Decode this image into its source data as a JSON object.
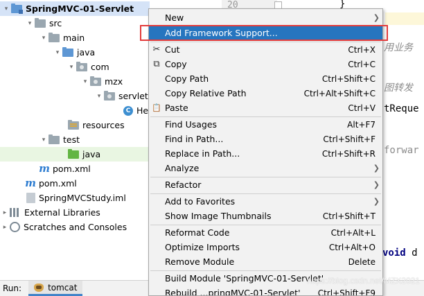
{
  "tree": {
    "items": [
      {
        "label": "SpringMVC-01-Servlet",
        "icon": "module-folder-icon",
        "arrow": "▾",
        "indent": 0
      },
      {
        "label": "src",
        "icon": "folder-icon",
        "arrow": "▾",
        "indent": 1
      },
      {
        "label": "main",
        "icon": "folder-icon",
        "arrow": "▾",
        "indent": 2
      },
      {
        "label": "java",
        "icon": "source-folder-icon",
        "arrow": "▾",
        "indent": 3
      },
      {
        "label": "com",
        "icon": "package-icon",
        "arrow": "▾",
        "indent": 4
      },
      {
        "label": "mzx",
        "icon": "package-icon",
        "arrow": "▾",
        "indent": 5
      },
      {
        "label": "servlet",
        "icon": "package-icon",
        "arrow": "▾",
        "indent": 6
      },
      {
        "label": "Hel",
        "icon": "java-class-icon",
        "arrow": "",
        "indent": 7
      },
      {
        "label": "resources",
        "icon": "resources-folder-icon",
        "arrow": "",
        "indent": 3
      },
      {
        "label": "test",
        "icon": "folder-icon",
        "arrow": "▾",
        "indent": 2
      },
      {
        "label": "java",
        "icon": "test-source-folder-icon",
        "arrow": "",
        "indent": 3
      },
      {
        "label": "pom.xml",
        "icon": "maven-icon",
        "arrow": "",
        "indent": 2
      },
      {
        "label": "pom.xml",
        "icon": "maven-icon",
        "arrow": "",
        "indent": 1
      },
      {
        "label": "SpringMVCStudy.iml",
        "icon": "iml-file-icon",
        "arrow": "",
        "indent": 1
      },
      {
        "label": "External Libraries",
        "icon": "libraries-icon",
        "arrow": "▸",
        "indent": 0
      },
      {
        "label": "Scratches and Consoles",
        "icon": "scratches-icon",
        "arrow": "▸",
        "indent": 0
      }
    ]
  },
  "editor": {
    "line_number": "20",
    "brace": "}",
    "frag1": "用业务",
    "frag2": "图转发",
    "frag3": "tReque",
    "frag4": "forwar",
    "frag5_kw": "void",
    "frag5_rest": " d"
  },
  "menu": {
    "items": [
      {
        "label": "New",
        "shortcut": "",
        "submenu": true,
        "icon": ""
      },
      {
        "label": "Add Framework Support...",
        "shortcut": "",
        "submenu": false,
        "icon": "",
        "selected": true
      },
      {
        "label": "Cut",
        "shortcut": "Ctrl+X",
        "submenu": false,
        "icon": "✂"
      },
      {
        "label": "Copy",
        "shortcut": "Ctrl+C",
        "submenu": false,
        "icon": "⧉"
      },
      {
        "label": "Copy Path",
        "shortcut": "Ctrl+Shift+C",
        "submenu": false,
        "icon": ""
      },
      {
        "label": "Copy Relative Path",
        "shortcut": "Ctrl+Alt+Shift+C",
        "submenu": false,
        "icon": ""
      },
      {
        "label": "Paste",
        "shortcut": "Ctrl+V",
        "submenu": false,
        "icon": "📋"
      },
      {
        "label": "Find Usages",
        "shortcut": "Alt+F7",
        "submenu": false,
        "icon": ""
      },
      {
        "label": "Find in Path...",
        "shortcut": "Ctrl+Shift+F",
        "submenu": false,
        "icon": ""
      },
      {
        "label": "Replace in Path...",
        "shortcut": "Ctrl+Shift+R",
        "submenu": false,
        "icon": ""
      },
      {
        "label": "Analyze",
        "shortcut": "",
        "submenu": true,
        "icon": ""
      },
      {
        "label": "Refactor",
        "shortcut": "",
        "submenu": true,
        "icon": ""
      },
      {
        "label": "Add to Favorites",
        "shortcut": "",
        "submenu": true,
        "icon": ""
      },
      {
        "label": "Show Image Thumbnails",
        "shortcut": "Ctrl+Shift+T",
        "submenu": false,
        "icon": ""
      },
      {
        "label": "Reformat Code",
        "shortcut": "Ctrl+Alt+L",
        "submenu": false,
        "icon": ""
      },
      {
        "label": "Optimize Imports",
        "shortcut": "Ctrl+Alt+O",
        "submenu": false,
        "icon": ""
      },
      {
        "label": "Remove Module",
        "shortcut": "Delete",
        "submenu": false,
        "icon": ""
      },
      {
        "label": "Build Module 'SpringMVC-01-Servlet'",
        "shortcut": "",
        "submenu": false,
        "icon": ""
      },
      {
        "label": "Rebuild ...pringMVC-01-Servlet'",
        "shortcut": "Ctrl+Shift+F9",
        "submenu": false,
        "icon": ""
      }
    ]
  },
  "runbar": {
    "label": "Run:",
    "tab_label": "tomcat"
  },
  "watermark": "https://blog.csdn.net/MZX2021",
  "colors": {
    "selection": "#2675bf",
    "highlight_box": "#e33b3b",
    "menu_bg": "#f2f2f2"
  }
}
